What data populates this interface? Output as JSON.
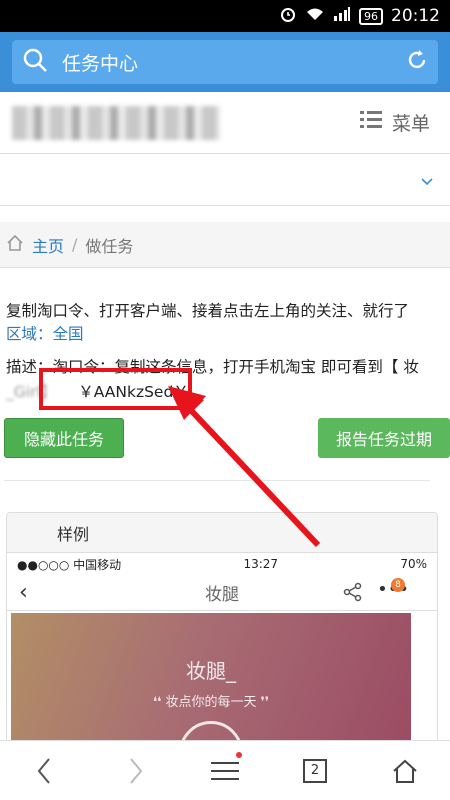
{
  "status": {
    "time": "20:12",
    "battery": "96"
  },
  "search": {
    "label": "任务中心"
  },
  "header": {
    "menu_label": "菜单"
  },
  "breadcrumb": {
    "home": "主页",
    "separator": "/",
    "current": "做任务"
  },
  "task": {
    "instruction": "复制淘口令、打开客户端、接着点击左上角的关注、就行了",
    "region": "区域：全国",
    "description": "描述：淘口令：复制这条信息，打开手机淘宝 即可看到【 妆",
    "code": "￥AANkzSed￥"
  },
  "buttons": {
    "hide": "隐藏此任务",
    "report": "报告任务过期"
  },
  "example": {
    "header": "样例",
    "phone_status_left": "●●○○○ 中国移动",
    "phone_time": "13:27",
    "phone_battery": "70%",
    "nav_title": "妆腿",
    "badge": "8",
    "banner_name": "妆腿_",
    "banner_slogan": "❛❛ 妆点你的每一天 ❜❜"
  },
  "bottomnav": {
    "tab_count": "2"
  },
  "colors": {
    "accent": "#3a8fd8",
    "green": "#4caf50",
    "red": "#e8141c"
  }
}
